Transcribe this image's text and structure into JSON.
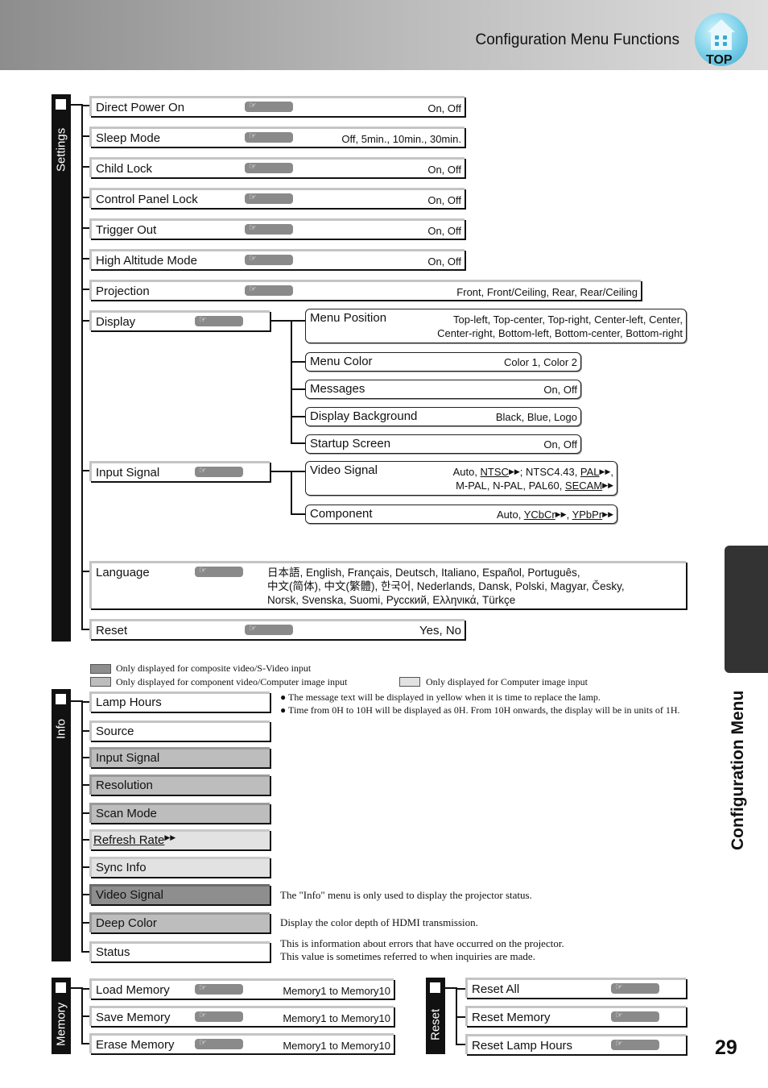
{
  "header": {
    "title": "Configuration Menu Functions",
    "top_button_label": "TOP"
  },
  "settings": {
    "tab_label": "Settings",
    "items": [
      {
        "label": "Direct Power On",
        "value": "On, Off"
      },
      {
        "label": "Sleep Mode",
        "value": "Off, 5min., 10min., 30min."
      },
      {
        "label": "Child Lock",
        "value": "On, Off"
      },
      {
        "label": "Control Panel Lock",
        "value": "On, Off"
      },
      {
        "label": "Trigger Out",
        "value": "On, Off"
      },
      {
        "label": "High Altitude Mode",
        "value": "On, Off"
      },
      {
        "label": "Projection",
        "value": "Front, Front/Ceiling, Rear, Rear/Ceiling"
      }
    ],
    "display": {
      "label": "Display",
      "sub": [
        {
          "label": "Menu Position",
          "value_line1": "Top-left, Top-center, Top-right, Center-left, Center,",
          "value_line2": "Center-right, Bottom-left, Bottom-center, Bottom-right"
        },
        {
          "label": "Menu Color",
          "value": "Color 1, Color 2"
        },
        {
          "label": "Messages",
          "value": "On, Off"
        },
        {
          "label": "Display Background",
          "value": "Black, Blue, Logo"
        },
        {
          "label": "Startup Screen",
          "value": "On, Off"
        }
      ]
    },
    "input_signal": {
      "label": "Input Signal",
      "video_signal": {
        "label": "Video Signal",
        "auto": "Auto, ",
        "ntsc": "NTSC",
        "ntsc443": "; NTSC4.43, ",
        "pal": "PAL",
        "comma": ",",
        "line2a": "M-PAL, N-PAL, PAL60, ",
        "secam": "SECAM"
      },
      "component": {
        "label": "Component",
        "auto": "Auto, ",
        "ycbcr": "YCbCr",
        "sep": ", ",
        "ypbpr": "YPbPr"
      }
    },
    "language": {
      "label": "Language",
      "line1": "日本語, English, Français, Deutsch, Italiano, Español, Português,",
      "line2": "中文(简体), 中文(繁體), 한국어, Nederlands, Dansk, Polski, Magyar, Česky,",
      "line3": "Norsk, Svenska, Suomi, Русский, Ελληνικά, Türkçe"
    },
    "reset": {
      "label": "Reset",
      "value": "Yes, No"
    }
  },
  "legend": {
    "composite": "Only displayed for composite video/S-Video input",
    "component": "Only displayed for component video/Computer image input",
    "computer": "Only displayed for Computer image input",
    "colors": {
      "composite": "#8e8e8e",
      "component": "#bdbdbd",
      "computer": "#e2e2e2"
    }
  },
  "info": {
    "tab_label": "Info",
    "notes": [
      "The message text will be displayed in yellow when it is time to replace the lamp.",
      "Time from 0H to 10H will be displayed as 0H. From 10H onwards, the display will be in units of 1H."
    ],
    "items": [
      {
        "label": "Lamp Hours"
      },
      {
        "label": "Source"
      },
      {
        "label": "Input Signal"
      },
      {
        "label": "Resolution"
      },
      {
        "label": "Scan Mode"
      },
      {
        "label": "Refresh Rate"
      },
      {
        "label": "Sync Info"
      },
      {
        "label": "Video Signal"
      },
      {
        "label": "Deep Color"
      },
      {
        "label": "Status"
      }
    ],
    "desc_info": "The \"Info\" menu is only used to display the projector status.",
    "desc_deep_color": "Display the color depth of HDMI transmission.",
    "desc_status_1": "This is information about errors that have occurred on the projector.",
    "desc_status_2": "This value is sometimes referred to when inquiries are made."
  },
  "memory": {
    "tab_label": "Memory",
    "items": [
      {
        "label": "Load Memory",
        "value": "Memory1 to Memory10"
      },
      {
        "label": "Save Memory",
        "value": "Memory1 to Memory10"
      },
      {
        "label": "Erase Memory",
        "value": "Memory1 to Memory10"
      }
    ]
  },
  "reset_menu": {
    "tab_label": "Reset",
    "items": [
      {
        "label": "Reset All"
      },
      {
        "label": "Reset Memory"
      },
      {
        "label": "Reset Lamp Hours"
      }
    ]
  },
  "side": {
    "label": "Configuration Menu"
  },
  "page_number": "29"
}
